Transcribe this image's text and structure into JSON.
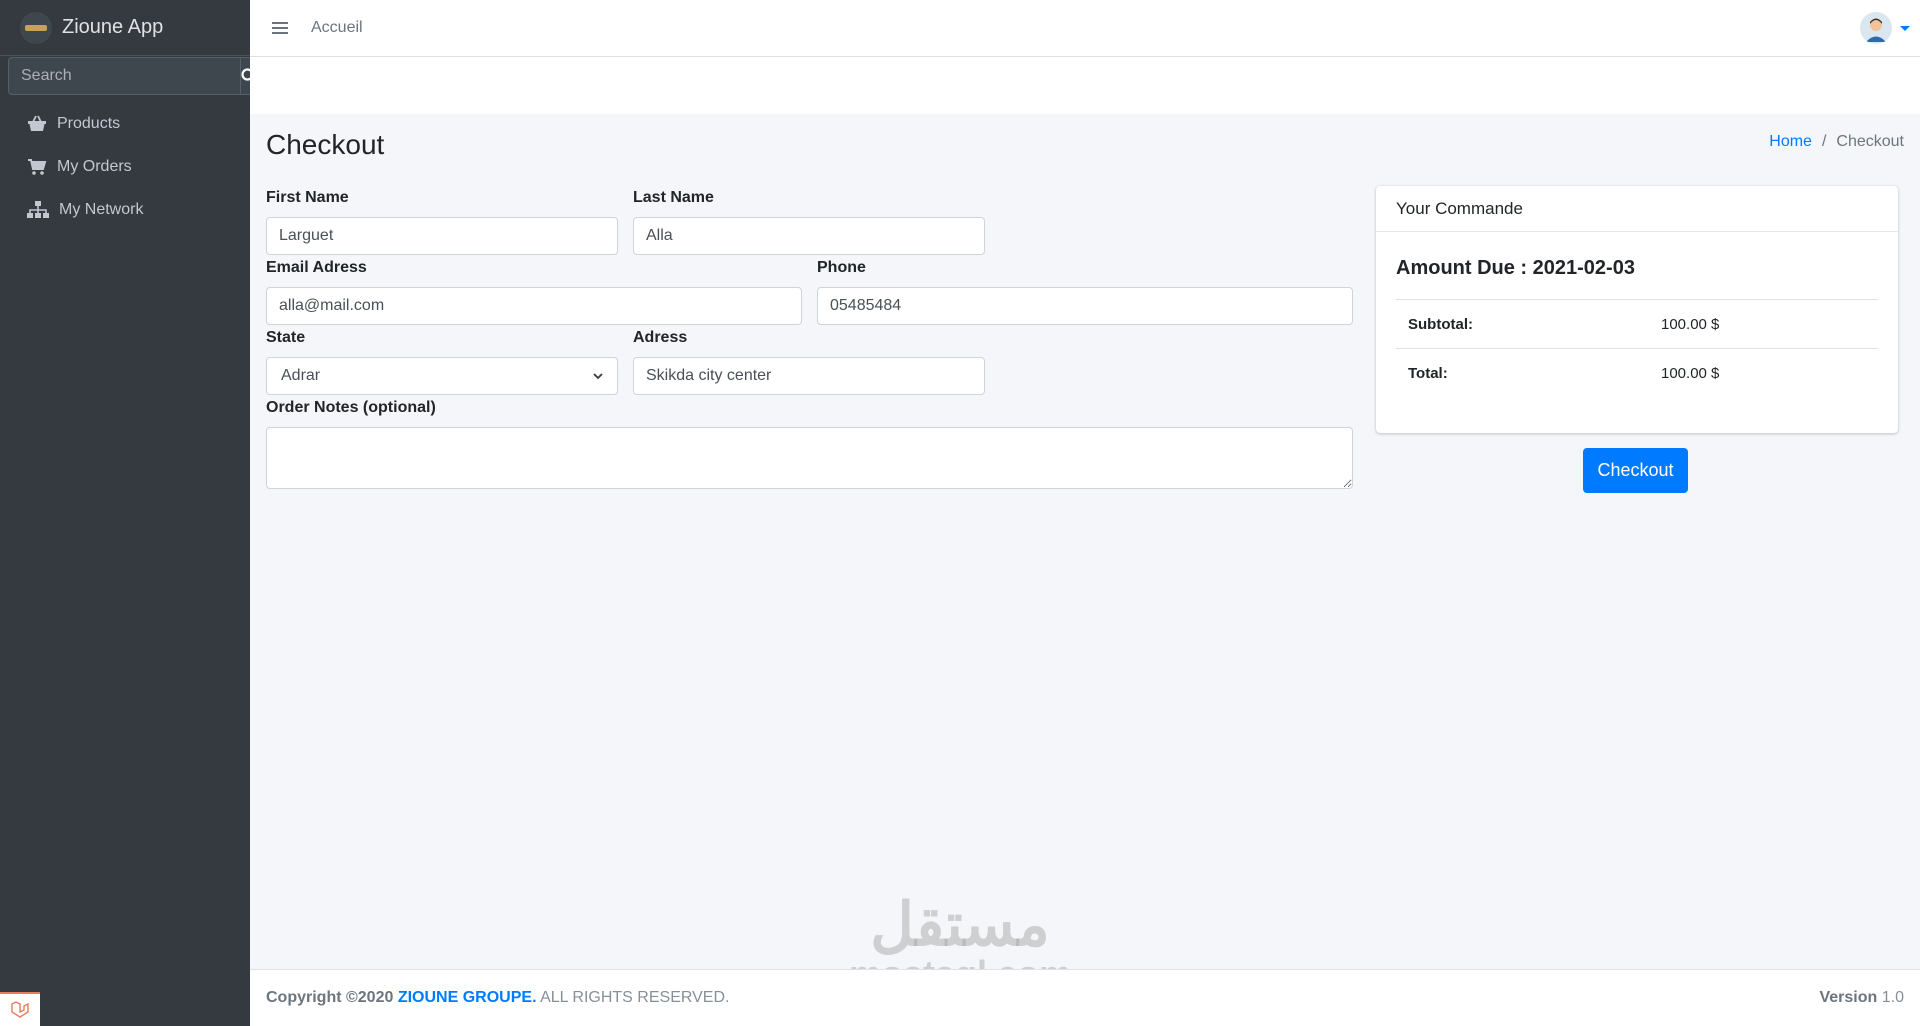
{
  "app": {
    "title": "Zioune App"
  },
  "search": {
    "placeholder": "Search"
  },
  "sidebar": {
    "items": [
      {
        "label": "Products",
        "icon": "basket-icon"
      },
      {
        "label": "My Orders",
        "icon": "cart-icon"
      },
      {
        "label": "My Network",
        "icon": "sitemap-icon"
      }
    ]
  },
  "topnav": {
    "home_link": "Accueil"
  },
  "page": {
    "title": "Checkout",
    "breadcrumb": {
      "home": "Home",
      "separator": "/",
      "current": "Checkout"
    }
  },
  "form": {
    "first_name": {
      "label": "First Name",
      "value": "Larguet"
    },
    "last_name": {
      "label": "Last Name",
      "value": "Alla"
    },
    "email": {
      "label": "Email Adress",
      "value": "alla@mail.com"
    },
    "phone": {
      "label": "Phone",
      "value": "05485484"
    },
    "state": {
      "label": "State",
      "value": "Adrar"
    },
    "address": {
      "label": "Adress",
      "value": "Skikda city center"
    },
    "notes": {
      "label": "Order Notes (optional)",
      "value": ""
    }
  },
  "order": {
    "header": "Your Commande",
    "amount_due": "Amount Due : 2021-02-03",
    "subtotal_label": "Subtotal:",
    "subtotal_value": "100.00 $",
    "total_label": "Total:",
    "total_value": "100.00 $",
    "checkout_label": "Checkout"
  },
  "watermark": {
    "arabic": "مستقل",
    "latin": "mostaql.com"
  },
  "footer": {
    "copyright_prefix": "Copyright ©2020",
    "company": "ZIOUNE GROUPE.",
    "rights": "ALL RIGHTS RESERVED.",
    "version_label": "Version",
    "version_value": "1.0"
  },
  "colors": {
    "sidebar": "#343a40",
    "accent": "#007bff",
    "background": "#f4f6f9"
  }
}
